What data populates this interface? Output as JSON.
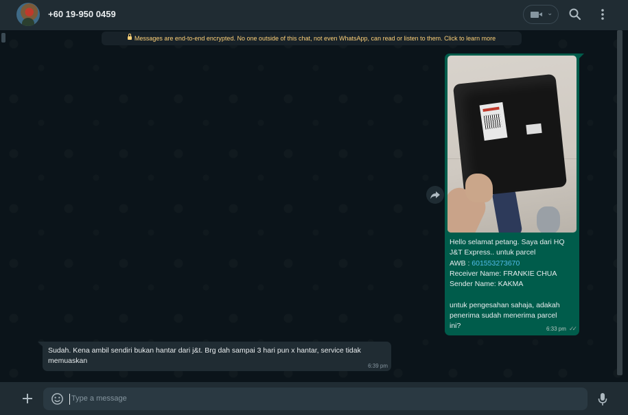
{
  "header": {
    "contact_name": "+60 19-950 0459",
    "video_call_icon": "video-camera-icon",
    "video_dropdown_icon": "chevron-down-icon",
    "search_icon": "search-icon",
    "menu_icon": "kebab-menu-icon"
  },
  "chat": {
    "encryption_notice": "Messages are end-to-end encrypted. No one outside of this chat, not even WhatsApp, can read or listen to them. Click to learn more",
    "outgoing": {
      "image_icon": "photo-of-parcel",
      "lines": [
        "Hello selamat petang. Saya dari HQ",
        "J&T Express.. untuk parcel"
      ],
      "awb_label": "AWB : ",
      "awb_value": "601553273670",
      "receiver": "Receiver Name:  FRANKIE CHUA",
      "sender": "Sender Name: KAKMA",
      "closing_lines": [
        "untuk pengesahan sahaja, adakah",
        "penerima sudah menerima parcel",
        "ini?"
      ],
      "time": "6:33 pm",
      "status_icon": "double-check-icon"
    },
    "incoming": {
      "text": "Sudah. Kena ambil sendiri bukan hantar dari j&t. Brg dah sampai 3 hari pun x hantar, service tidak memuaskan",
      "time": "6:39 pm"
    }
  },
  "footer": {
    "attach_icon": "plus-icon",
    "emoji_icon": "emoji-icon",
    "placeholder": "Type a message",
    "mic_icon": "microphone-icon"
  },
  "colors": {
    "outgoing_bubble": "#005c4b",
    "incoming_bubble": "#202c33",
    "link": "#53bdeb",
    "encryption_text": "#ffd279"
  }
}
